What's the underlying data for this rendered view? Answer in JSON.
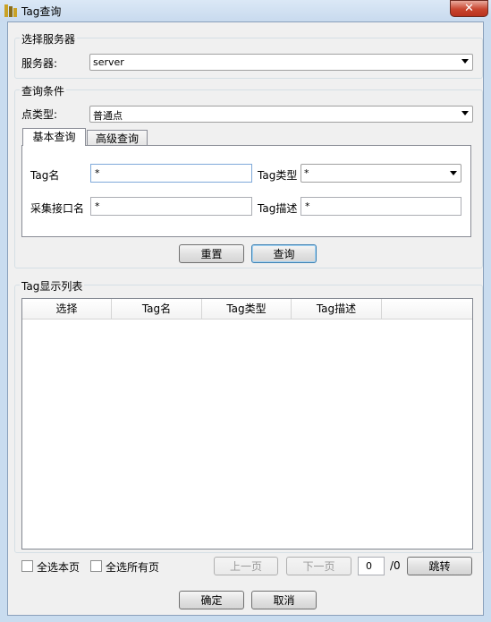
{
  "window": {
    "title": "Tag查询",
    "close_glyph": "✕"
  },
  "server_group": {
    "title": "选择服务器",
    "server_label": "服务器:",
    "server_value": "server"
  },
  "query_group": {
    "title": "查询条件",
    "point_type_label": "点类型:",
    "point_type_value": "普通点",
    "tabs": [
      {
        "label": "基本查询",
        "active": true
      },
      {
        "label": "高级查询",
        "active": false
      }
    ],
    "tag_name_label": "Tag名",
    "tag_name_value": "*",
    "tag_type_label": "Tag类型",
    "tag_type_value": "*",
    "interface_label": "采集接口名",
    "interface_value": "*",
    "tag_desc_label": "Tag描述",
    "tag_desc_value": "*",
    "reset_label": "重置",
    "search_label": "查询"
  },
  "list_group": {
    "title": "Tag显示列表",
    "columns": [
      "选择",
      "Tag名",
      "Tag类型",
      "Tag描述"
    ]
  },
  "footer": {
    "select_page_label": "全选本页",
    "select_all_label": "全选所有页",
    "prev_label": "上一页",
    "next_label": "下一页",
    "page_value": "0",
    "page_total": "/0",
    "jump_label": "跳转",
    "ok_label": "确定",
    "cancel_label": "取消"
  }
}
